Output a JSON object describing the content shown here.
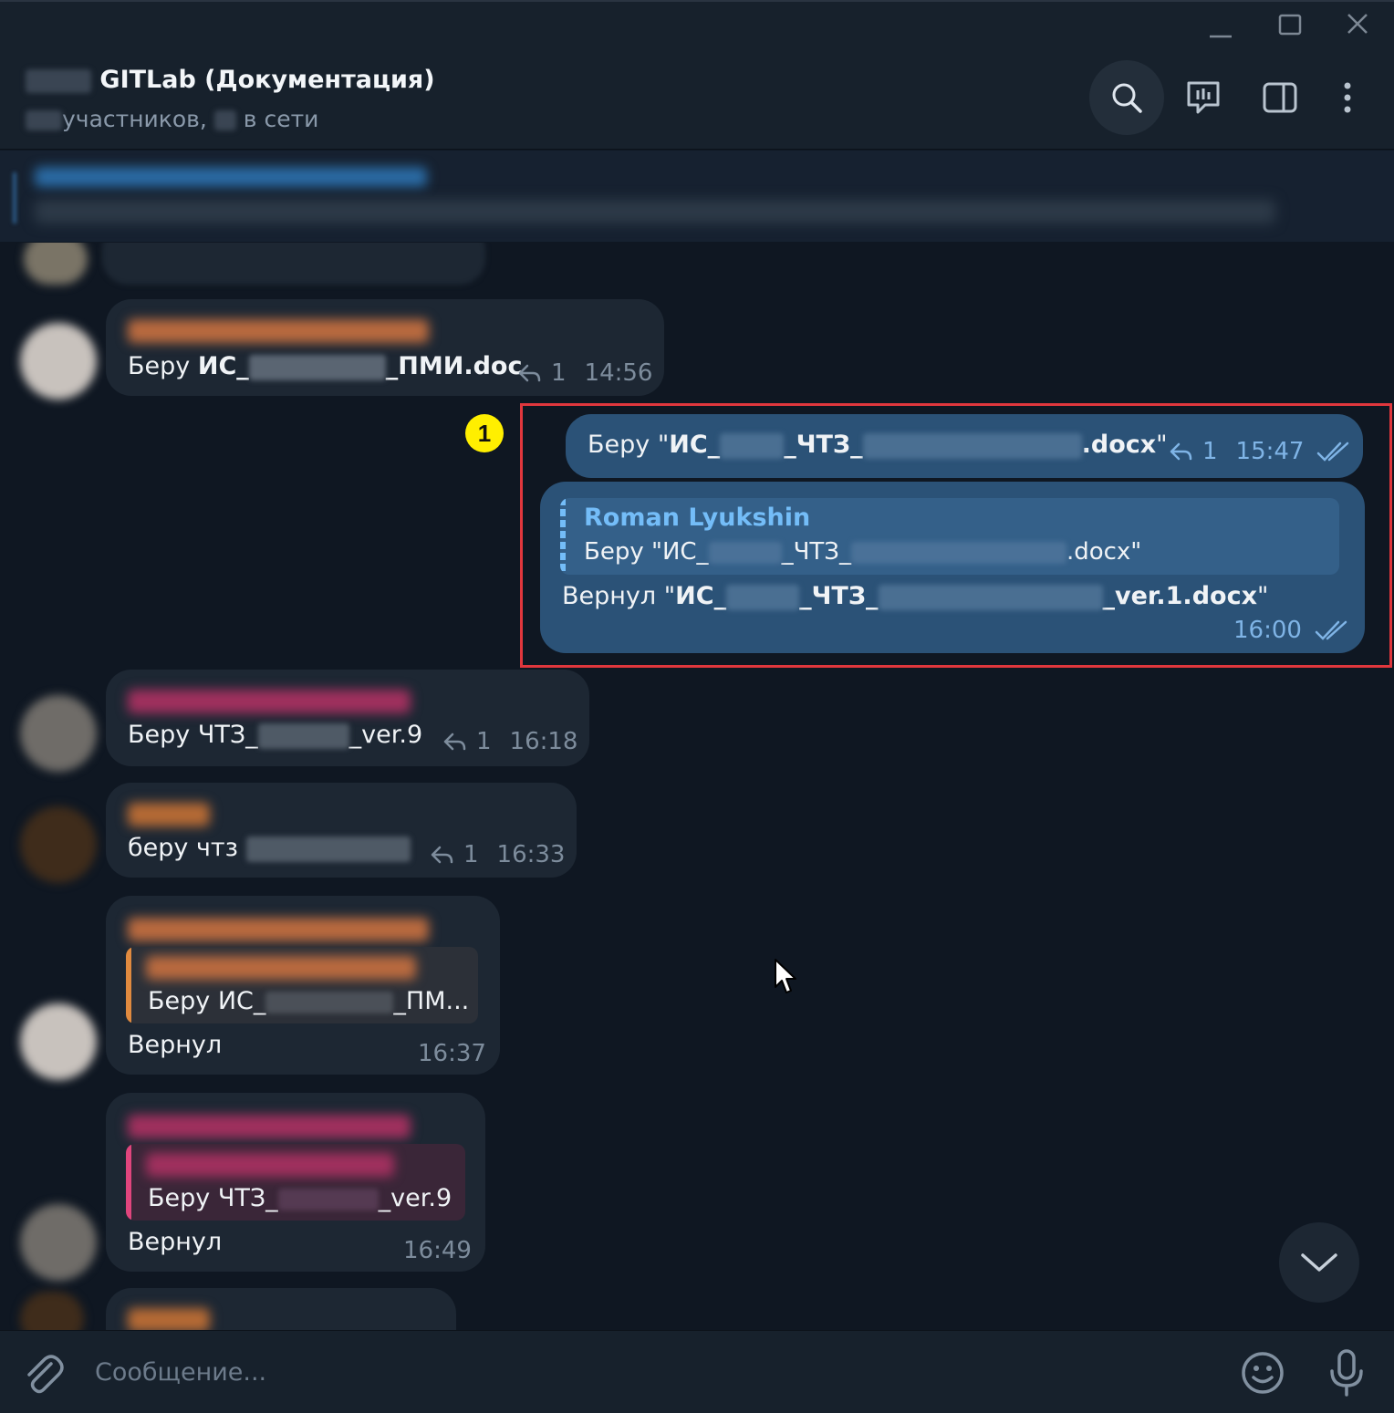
{
  "window": {
    "controls": {
      "minimize_icon": "minimize-icon",
      "maximize_icon": "maximize-icon",
      "close_icon": "close-icon"
    }
  },
  "header": {
    "title": "GITLab (Документация)",
    "subtitle_members": "участников,",
    "subtitle_online": "в сети",
    "icons": [
      "search-icon",
      "polls-icon",
      "sidebar-toggle-icon",
      "more-vertical-icon"
    ]
  },
  "messages": [
    {
      "id": "m1",
      "text_prefix": "Беру ",
      "bold_start": "ИС_",
      "bold_end": "_ПМИ.doc",
      "replies": "1",
      "time": "14:56"
    },
    {
      "id": "m2",
      "text_prefix": "Беру \"",
      "bold_start": "ИС_",
      "bold_mid": "_ЧТЗ_",
      "bold_end": ".docx",
      "text_suffix": "\"",
      "replies": "1",
      "time": "15:47",
      "status": "read"
    },
    {
      "id": "m3",
      "reply_author": "Roman Lyukshin",
      "reply_text_start": "Беру \"ИС_",
      "reply_text_mid": "_ЧТЗ_",
      "reply_text_end": ".docx\"",
      "text_prefix": "Вернул \"",
      "bold_start": "ИС_",
      "bold_mid": "_ЧТЗ_",
      "bold_end": "_ver.1.docx",
      "text_suffix": "\"",
      "time": "16:00",
      "status": "read"
    },
    {
      "id": "m4",
      "text_start": "Беру ЧТЗ_",
      "text_end": "_ver.9",
      "replies": "1",
      "time": "16:18"
    },
    {
      "id": "m5",
      "text_start": "беру чтз",
      "replies": "1",
      "time": "16:33"
    },
    {
      "id": "m6",
      "quote_start": "Беру ИС_",
      "quote_end": "_ПМ...",
      "text": "Вернул",
      "time": "16:37"
    },
    {
      "id": "m7",
      "quote_start": "Беру ЧТЗ_",
      "quote_end": "_ver.9",
      "text": "Вернул",
      "time": "16:49"
    }
  ],
  "annotation": {
    "step_number": "1"
  },
  "composer": {
    "placeholder": "Сообщение...",
    "icons": [
      "attach-icon",
      "emoji-icon",
      "microphone-icon"
    ]
  },
  "colors": {
    "outgoing_bubble": "#2b5277",
    "incoming_bubble": "#1d2733",
    "accent": "#74bdf8",
    "highlight": "#e0373d",
    "step_badge": "#ffef00"
  }
}
